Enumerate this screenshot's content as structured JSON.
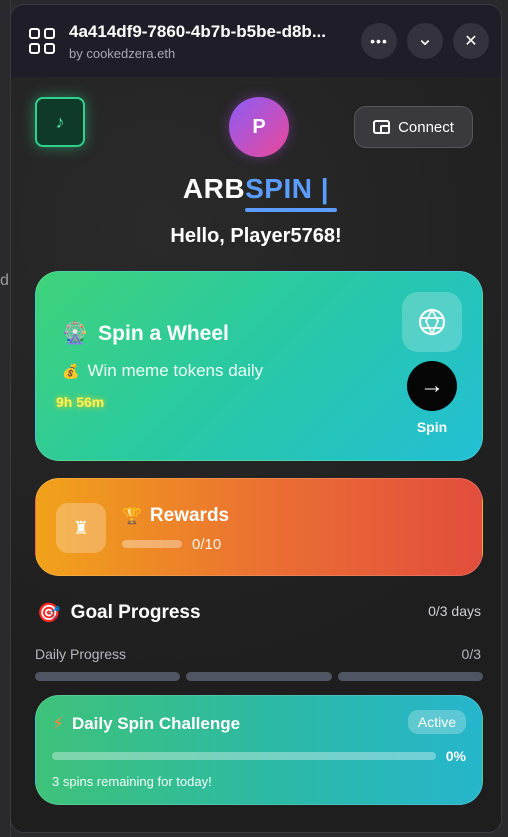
{
  "window": {
    "title": "4a414df9-7860-4b7b-b5be-d8b...",
    "subtitle": "by cookedzera.eth",
    "more_label": "•••",
    "chevron_label": "⌄",
    "close_label": "✕"
  },
  "backdrop": {
    "side_letter": "d"
  },
  "header": {
    "music_icon": "♪",
    "avatar_letter": "P",
    "connect_label": "Connect"
  },
  "logo": {
    "part1": "ARB",
    "part2": "SPIN",
    "cursor": "|"
  },
  "greeting": "Hello, Player5768!",
  "spin_card": {
    "emoji": "🎡",
    "title": "Spin a Wheel",
    "sub_emoji": "💰",
    "subtitle": "Win meme tokens daily",
    "timer": "9h 56m",
    "arrow": "→",
    "button_label": "Spin"
  },
  "rewards_card": {
    "trophy_box_icon": "♜",
    "emoji": "🏆",
    "title": "Rewards",
    "progress": 0.0,
    "count": "0/10"
  },
  "goal": {
    "emoji": "🎯",
    "title": "Goal Progress",
    "days": "0/3 days",
    "daily_label": "Daily Progress",
    "daily_count": "0/3",
    "segments_filled": 0,
    "segments_total": 3
  },
  "challenge": {
    "emoji": "⚡",
    "title": "Daily Spin Challenge",
    "status": "Active",
    "percent": "0%",
    "progress": 0.0,
    "note": "3 spins remaining for today!"
  },
  "colors": {
    "accent_blue": "#5b9dff",
    "spin_green": "#3fd37a",
    "spin_cyan": "#22bfd6",
    "rewards_orange": "#f1a21a",
    "rewards_red": "#e24d3c",
    "timer_yellow": "#fff35a"
  }
}
